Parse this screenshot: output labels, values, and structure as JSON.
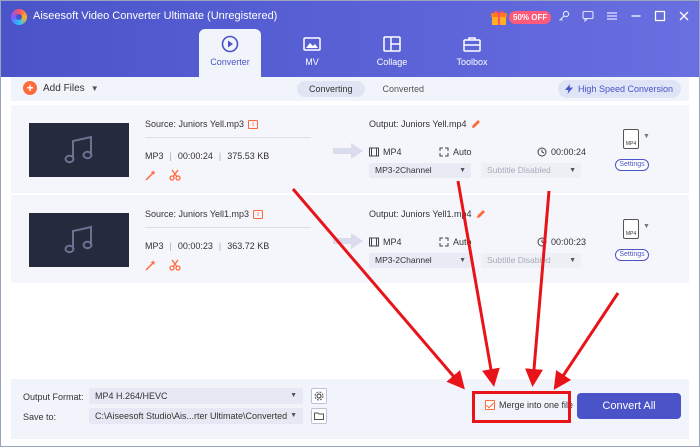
{
  "window": {
    "title": "Aiseesoft Video Converter Ultimate (Unregistered)",
    "promo_badge": "50% OFF",
    "icons": [
      "key-icon",
      "chat-icon",
      "menu-icon",
      "minimize-icon",
      "maximize-icon",
      "close-icon"
    ]
  },
  "tabs": [
    {
      "label": "Converter",
      "icon": "converter-icon",
      "active": true
    },
    {
      "label": "MV",
      "icon": "mv-icon",
      "active": false
    },
    {
      "label": "Collage",
      "icon": "collage-icon",
      "active": false
    },
    {
      "label": "Toolbox",
      "icon": "toolbox-icon",
      "active": false
    }
  ],
  "toolbar": {
    "add_files": "Add Files",
    "converting": "Converting",
    "converted": "Converted",
    "high_speed": "High Speed Conversion"
  },
  "files": [
    {
      "source": "Source: Juniors Yell.mp3",
      "format": "MP3",
      "duration": "00:00:24",
      "size": "375.53 KB",
      "output": "Output: Juniors Yell.mp4",
      "out_format": "MP4",
      "resolution": "Auto",
      "out_duration": "00:00:24",
      "audio": "MP3-2Channel",
      "subtitle": "Subtitle Disabled",
      "settings": "Settings",
      "fmt_badge": "MP4"
    },
    {
      "source": "Source: Juniors Yell1.mp3",
      "format": "MP3",
      "duration": "00:00:23",
      "size": "363.72 KB",
      "output": "Output: Juniors Yell1.mp4",
      "out_format": "MP4",
      "resolution": "Auto",
      "out_duration": "00:00:23",
      "audio": "MP3-2Channel",
      "subtitle": "Subtitle Disabled",
      "settings": "Settings",
      "fmt_badge": "MP4"
    }
  ],
  "bottom": {
    "output_format_label": "Output Format:",
    "output_format_value": "MP4 H.264/HEVC",
    "save_to_label": "Save to:",
    "save_to_value": "C:\\Aiseesoft Studio\\Ais...rter Ultimate\\Converted",
    "merge_label": "Merge into one file",
    "merge_checked": true,
    "convert_all": "Convert All"
  },
  "colors": {
    "accent": "#4a54c8",
    "orange": "#ff6a3a",
    "annotation_red": "#e8141a"
  }
}
